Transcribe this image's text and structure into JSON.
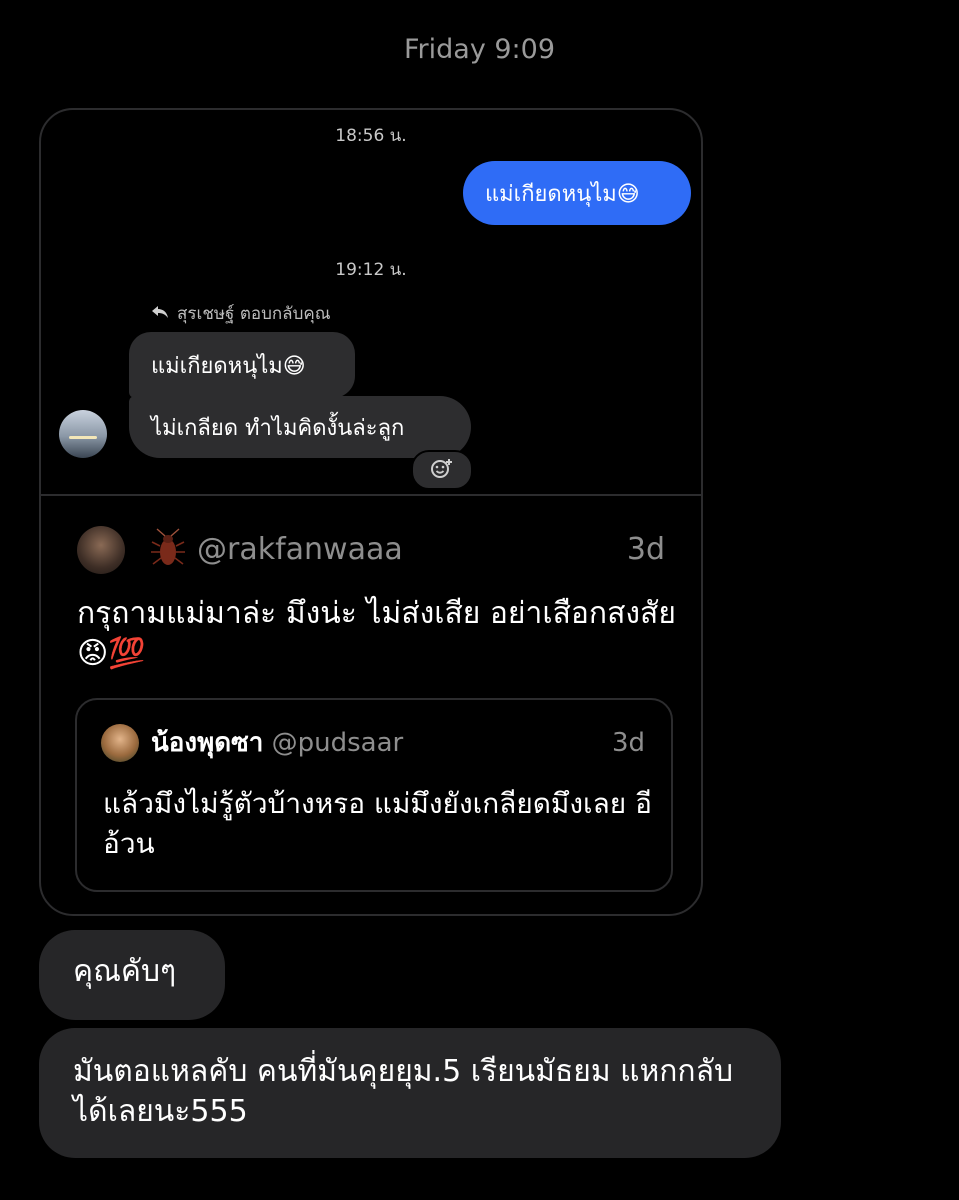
{
  "header": {
    "timestamp": "Friday 9:09"
  },
  "story_card": {
    "timestamp_1": "18:56 น.",
    "sent_message": "แม่เกียดหนุไม😅",
    "timestamp_2": "19:12 น.",
    "reply_label": "สุรเชษฐ์ ตอบกลับคุณ",
    "quoted_message": "แม่เกียดหนุไม😅",
    "reply_message": "ไม่เกลียด ทำไมคิดงั้นล่ะลูก",
    "post": {
      "handle": "@rakfanwaaa",
      "time": "3d",
      "text": "กรุถามแม่มาล่ะ มึงน่ะ ไม่ส่งเสีย อย่าเสือกสงสัย😡💯",
      "quote": {
        "name": "น้องพุดซา",
        "handle": "@pudsaar",
        "time": "3d",
        "text": "แล้วมึงไม่รู้ตัวบ้างหรอ แม่มึงยังเกลียดมึงเลย อีอ้วน"
      }
    }
  },
  "messages": [
    {
      "text": "คุณคับๆ"
    },
    {
      "text": "มันตอแหลคับ คนที่มันคุยยุม.5 เรียนมัธยม แหกกลับได้เลยนะ555"
    }
  ],
  "colors": {
    "accent": "#2f6cf6",
    "bubble_dark": "#2d2d2f",
    "background": "#000000"
  },
  "icons": [
    "reply-arrow-icon",
    "add-reaction-icon",
    "cockroach-emoji-icon"
  ]
}
